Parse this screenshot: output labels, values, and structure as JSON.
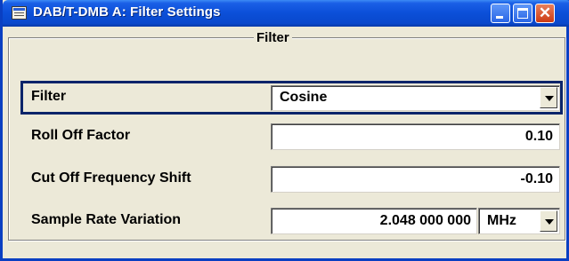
{
  "window": {
    "title": "DAB/T-DMB A: Filter Settings"
  },
  "group": {
    "label": "Filter"
  },
  "rows": {
    "filter": {
      "label": "Filter",
      "value": "Cosine"
    },
    "roll_off": {
      "label": "Roll Off Factor",
      "value": "0.10"
    },
    "cut_off": {
      "label": "Cut Off Frequency Shift",
      "value": "-0.10"
    },
    "sample_rate": {
      "label": "Sample Rate Variation",
      "value": "2.048 000 000",
      "unit": "MHz"
    }
  },
  "colors": {
    "titlebar": "#0b4fd8",
    "dialog_bg": "#ece9d8",
    "focus_border": "#0a246a",
    "close_button": "#cc3a14"
  }
}
